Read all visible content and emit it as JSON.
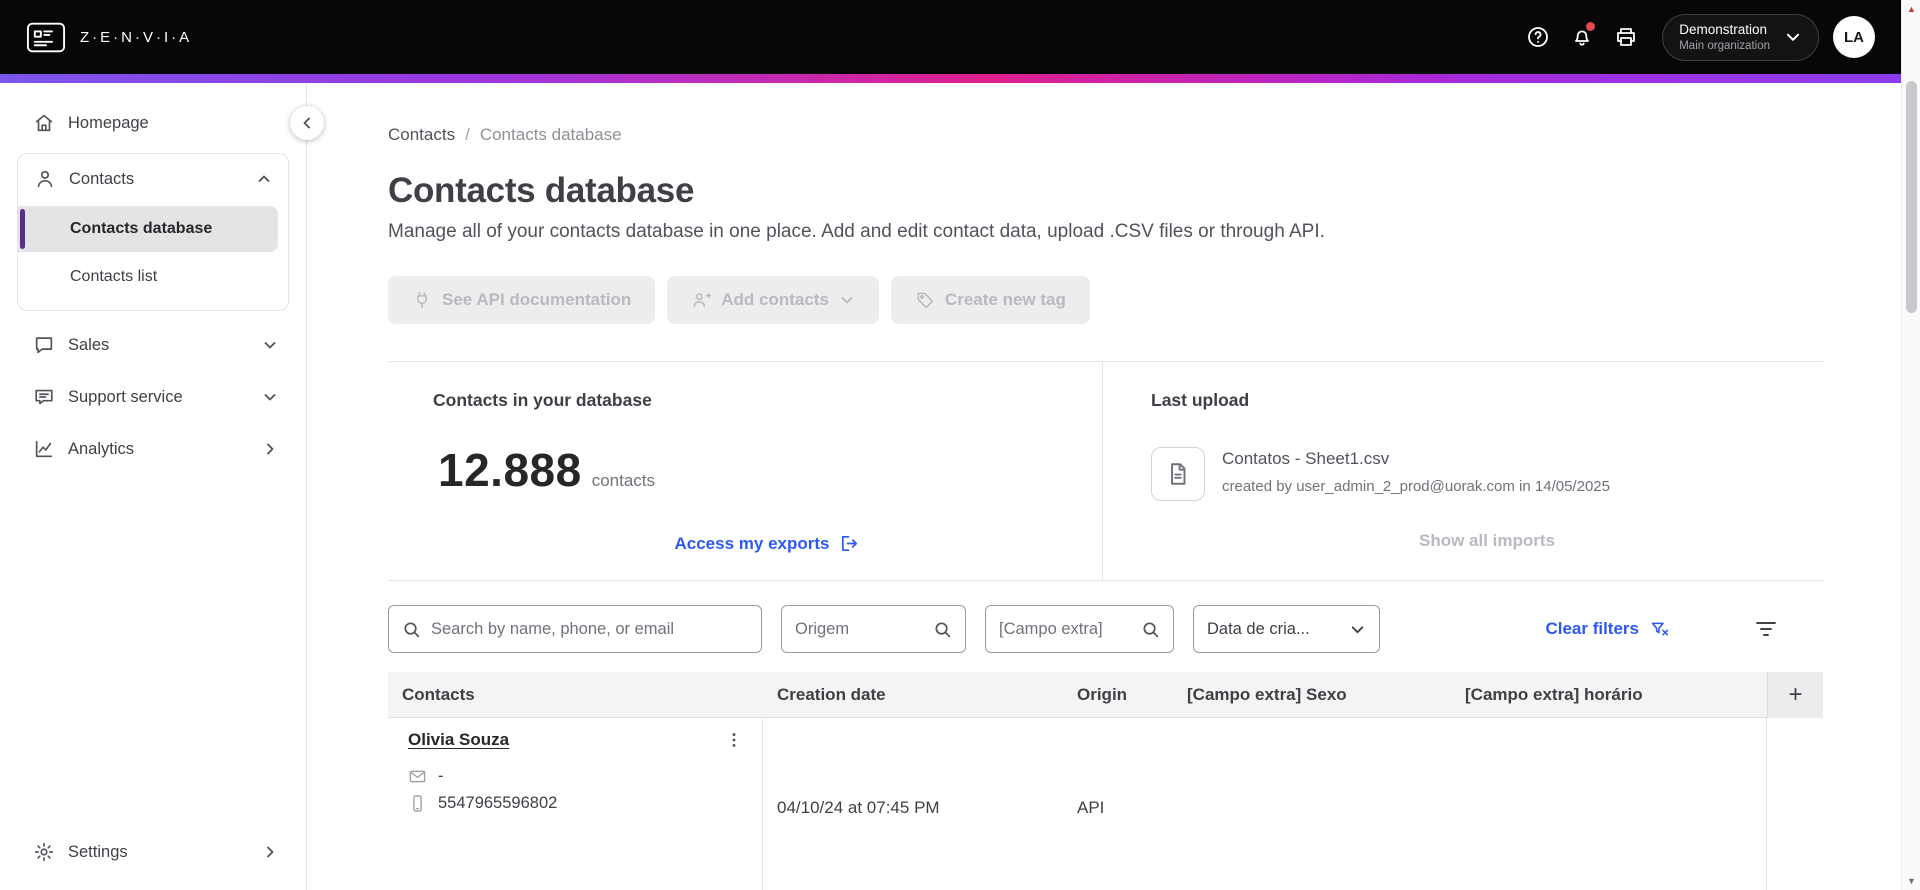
{
  "topbar": {
    "brand": "Z·E·N·V·I·A",
    "org_name": "Demonstration",
    "org_sub": "Main organization",
    "avatar": "LA"
  },
  "sidebar": {
    "items": [
      {
        "label": "Homepage"
      },
      {
        "label": "Contacts"
      },
      {
        "label": "Contacts database"
      },
      {
        "label": "Contacts list"
      },
      {
        "label": "Sales"
      },
      {
        "label": "Support service"
      },
      {
        "label": "Analytics"
      },
      {
        "label": "Settings"
      }
    ]
  },
  "breadcrumb": {
    "items": [
      "Contacts",
      "Contacts database"
    ],
    "separator": "/"
  },
  "page": {
    "title": "Contacts database",
    "subtitle": "Manage all of your contacts database in one place. Add and edit contact data, upload .CSV files or through API."
  },
  "actions": {
    "see_api": "See API documentation",
    "add_contacts": "Add contacts",
    "create_tag": "Create new tag"
  },
  "stats": {
    "database_title": "Contacts in your database",
    "count": "12.888",
    "count_unit": "contacts",
    "exports_link": "Access my exports",
    "last_upload_title": "Last upload",
    "file_name": "Contatos - Sheet1.csv",
    "file_meta": "created by user_admin_2_prod@uorak.com in 14/05/2025",
    "show_all_imports": "Show all imports"
  },
  "filters": {
    "search_placeholder": "Search by name, phone, or email",
    "origin_placeholder": "Origem",
    "extra_placeholder": "[Campo extra]",
    "date_label": "Data de cria...",
    "clear_label": "Clear filters"
  },
  "table": {
    "headers": [
      "Contacts",
      "Creation date",
      "Origin",
      "[Campo extra] Sexo",
      "[Campo extra] horário"
    ],
    "add_column_label": "+",
    "rows": [
      {
        "name": "Olivia Souza",
        "email": "-",
        "phone": "5547965596802",
        "creation_date": "04/10/24 at 07:45 PM",
        "origin": "API"
      }
    ]
  },
  "colors": {
    "accent_blue": "#2e58f2",
    "sidebar_accent": "#5b2d90",
    "notification_red": "#e5484d",
    "gradient": [
      "#7a55ee",
      "#df1f8e",
      "#8b3cf0"
    ]
  }
}
